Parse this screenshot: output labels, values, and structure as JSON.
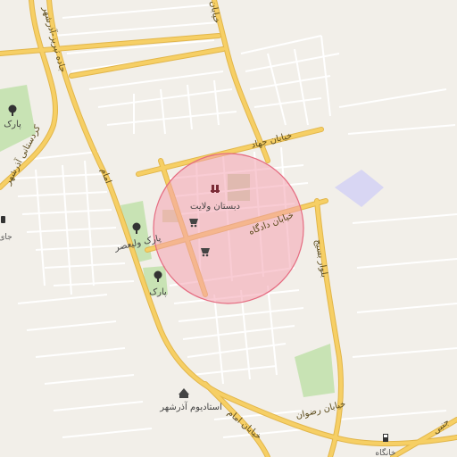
{
  "map": {
    "colors": {
      "background": "#f2efe9",
      "minor_road": "#ffffff",
      "major_road": "#f6cf65",
      "major_road_casing": "#e2b64a",
      "park": "#c8e3b4",
      "water_area": "#d8d6f3",
      "block": "#e6e2da",
      "search_circle_fill": "#f4a3b1",
      "search_circle_stroke": "#e56b80"
    },
    "labels": {
      "school": "دبستان ولایت",
      "street_jahad": "خیابان جهاد",
      "street_dadgah": "خیابان دادگاه",
      "park_valiasr": "پارک ولیعصر",
      "park_1": "پارک",
      "park_2": "پارک",
      "stadium": "استادیوم آذرشهر",
      "street_imam": "خیابان امام",
      "street_imam_2": "امام",
      "street_rezvan": "خیابان رضوان",
      "boulevard_basij": "بلوار بسیج",
      "road_tabriz": "جاده تبریز-آذرشهر",
      "street_kordestani": "کردستانی آذرشهر",
      "khanegah": "خانگاه",
      "jay": "جای",
      "street_top": "خیابان",
      "street_jenabi": "جنبی"
    },
    "icons": {
      "school": "school-icon",
      "shop": "shopping-cart-icon",
      "park": "tree-icon",
      "stadium": "stadium-icon",
      "fuel": "fuel-pump-icon",
      "transit": "transit-icon"
    }
  }
}
